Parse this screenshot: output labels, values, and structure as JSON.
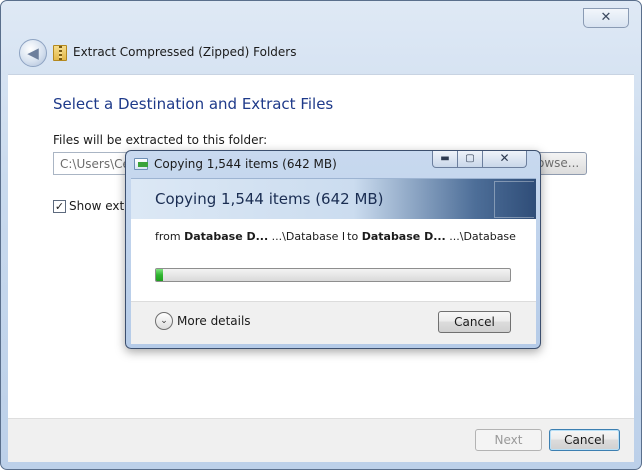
{
  "wizard": {
    "title": "Extract Compressed (Zipped) Folders",
    "close_glyph": "✕",
    "back_glyph": "◀",
    "heading": "Select a Destination and Extract Files",
    "files_label": "Files will be extracted to this folder:",
    "path_value": "C:\\Users\\Cer",
    "browse_label": "owse...",
    "show_checkbox_checked": true,
    "show_checkbox_glyph": "✓",
    "show_label": "Show extra",
    "next_label": "Next",
    "cancel_label": "Cancel"
  },
  "copy_dialog": {
    "title": "Copying 1,544 items (642 MB)",
    "caption": {
      "minimize": "▬",
      "maximize": "▢",
      "close": "✕"
    },
    "banner_title": "Copying 1,544 items (642 MB)",
    "from_prefix": "from",
    "from_name": "Database D...",
    "from_path": "...\\Database De",
    "to_prefix": "to",
    "to_name": "Database D...",
    "to_path": "...\\Database De",
    "progress_fraction": 0.02,
    "more_details_glyph": "⌄",
    "more_details_label": "More details",
    "cancel_label": "Cancel"
  },
  "colors": {
    "accent_heading": "#1e3a8a",
    "progress_green": "#2fb52f"
  }
}
